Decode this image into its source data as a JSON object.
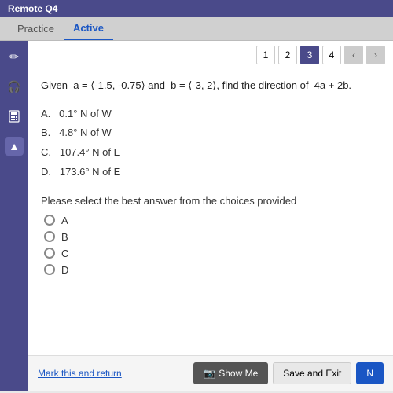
{
  "topbar": {
    "title": "Remote Q4"
  },
  "tabs": [
    {
      "id": "practice",
      "label": "Practice",
      "active": false
    },
    {
      "id": "active",
      "label": "Active",
      "active": true
    }
  ],
  "sidebar": {
    "icons": [
      {
        "id": "pencil",
        "symbol": "✏",
        "active": false
      },
      {
        "id": "headphones",
        "symbol": "🎧",
        "active": false
      },
      {
        "id": "calculator",
        "symbol": "▦",
        "active": false
      },
      {
        "id": "up-arrow",
        "symbol": "▲",
        "active": true
      }
    ]
  },
  "question_nav": {
    "buttons": [
      {
        "label": "1",
        "current": false
      },
      {
        "label": "2",
        "current": false
      },
      {
        "label": "3",
        "current": true
      },
      {
        "label": "4",
        "current": false
      }
    ],
    "prev_arrow": "‹",
    "next_arrow": "›"
  },
  "question": {
    "text": "Given  a⃗ = ⟨-1.5, -0.75⟩ and  b⃗ = ⟨-3, 2⟩, find the direction of  4a⃗ + 2b⃗.",
    "choices": [
      {
        "id": "A",
        "label": "A.",
        "text": "0.1° N of W"
      },
      {
        "id": "B",
        "label": "B.",
        "text": "4.8° N of W"
      },
      {
        "id": "C",
        "label": "C.",
        "text": "107.4° N of E"
      },
      {
        "id": "D",
        "label": "D.",
        "text": "173.6° N of E"
      }
    ],
    "select_prompt": "Please select the best answer from the choices provided",
    "radio_options": [
      "A",
      "B",
      "C",
      "D"
    ]
  },
  "footer": {
    "mark_return_label": "Mark this and return",
    "show_me_label": "Show Me",
    "save_exit_label": "Save and Exit",
    "next_label": "N"
  }
}
